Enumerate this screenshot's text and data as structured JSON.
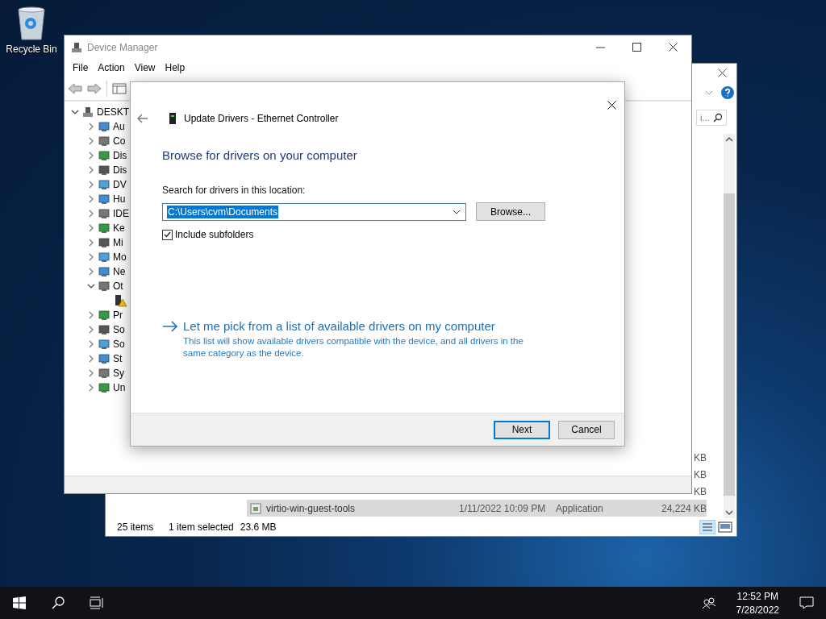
{
  "desktop": {
    "icons": [
      {
        "label": "Recycle Bin"
      }
    ]
  },
  "explorer": {
    "search": {
      "placeholder": "i..."
    },
    "rows": [
      {
        "size": "KB",
        "selected": false
      },
      {
        "size": "KB",
        "selected": false
      },
      {
        "size": "KB",
        "selected": false
      },
      {
        "name": "virtio-win-guest-tools",
        "date": "1/11/2022 10:09 PM",
        "type": "Application",
        "size": "24,224 KB",
        "selected": true
      }
    ],
    "status": {
      "count": "25 items",
      "selection": "1 item selected",
      "size": "23.6 MB"
    }
  },
  "device_manager": {
    "title": "Device Manager",
    "menu": [
      "File",
      "Action",
      "View",
      "Help"
    ],
    "tree": {
      "label": "DESKT",
      "kind": "category",
      "expanded": true,
      "children": [
        {
          "label": "Au",
          "kind": "category",
          "expanded": false
        },
        {
          "label": "Co",
          "kind": "category",
          "expanded": false
        },
        {
          "label": "Dis",
          "kind": "category",
          "expanded": false
        },
        {
          "label": "Dis",
          "kind": "category",
          "expanded": false
        },
        {
          "label": "DV",
          "kind": "category",
          "expanded": false
        },
        {
          "label": "Hu",
          "kind": "category",
          "expanded": false
        },
        {
          "label": "IDE",
          "kind": "category",
          "expanded": false
        },
        {
          "label": "Ke",
          "kind": "category",
          "expanded": false
        },
        {
          "label": "Mi",
          "kind": "category",
          "expanded": false
        },
        {
          "label": "Mo",
          "kind": "category",
          "expanded": false
        },
        {
          "label": "Ne",
          "kind": "category",
          "expanded": false
        },
        {
          "label": "Ot",
          "kind": "category",
          "expanded": true,
          "children": [
            {
              "kind": "warning-device"
            }
          ]
        },
        {
          "label": "Pr",
          "kind": "category",
          "expanded": false
        },
        {
          "label": "So",
          "kind": "category",
          "expanded": false
        },
        {
          "label": "So",
          "kind": "category",
          "expanded": false
        },
        {
          "label": "St",
          "kind": "category",
          "expanded": false
        },
        {
          "label": "Sy",
          "kind": "category",
          "expanded": false
        },
        {
          "label": "Un",
          "kind": "category",
          "expanded": false
        }
      ]
    }
  },
  "dialog": {
    "title": "Update Drivers - Ethernet Controller",
    "heading": "Browse for drivers on your computer",
    "location_label": "Search for drivers in this location:",
    "location": {
      "value": "C:\\Users\\cvm\\Documents",
      "selected": true
    },
    "browse": "Browse...",
    "include_subfolders": {
      "label": "Include subfolders",
      "checked": true
    },
    "pick": {
      "title": "Let me pick from a list of available drivers on my computer",
      "description": "This list will show available drivers compatible with the device, and all drivers in the same category as the device."
    },
    "buttons": [
      {
        "label": "Next",
        "default": true
      },
      {
        "label": "Cancel",
        "default": false
      }
    ]
  },
  "taskbar": {
    "time": "12:52 PM",
    "date": "7/28/2022"
  }
}
